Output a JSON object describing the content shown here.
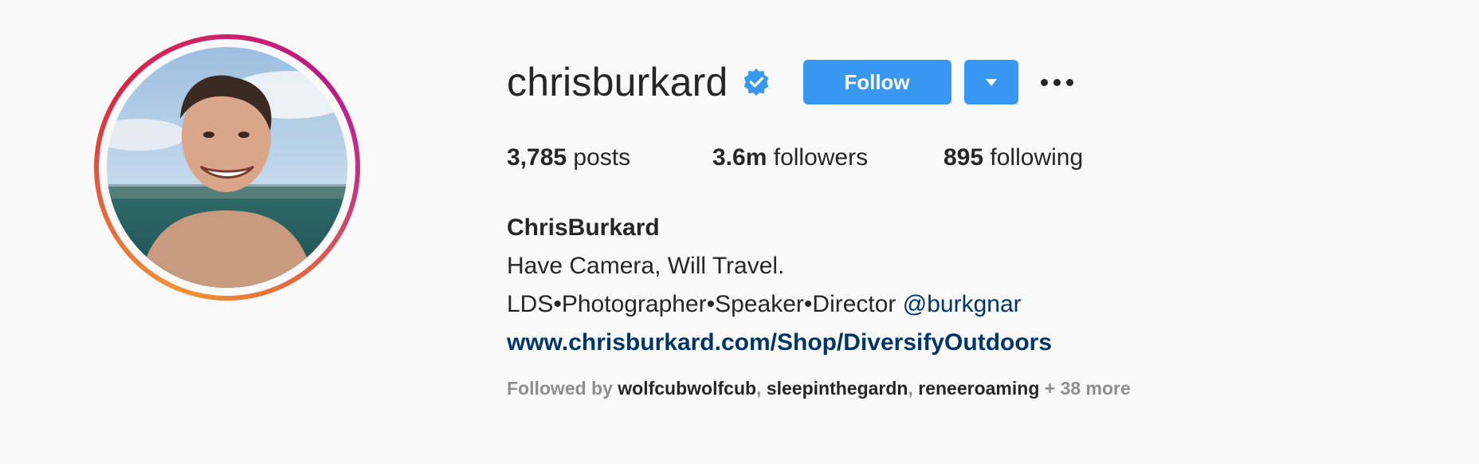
{
  "profile": {
    "username": "chrisburkard",
    "follow_label": "Follow",
    "stats": {
      "posts_count": "3,785",
      "posts_label": "posts",
      "followers_count": "3.6m",
      "followers_label": "followers",
      "following_count": "895",
      "following_label": "following"
    },
    "full_name": "ChrisBurkard",
    "bio_line1": "Have Camera, Will Travel.",
    "bio_line2": "LDS•Photographer•Speaker•Director",
    "mention": "@burkgnar",
    "website": "www.chrisburkard.com/Shop/DiversifyOutdoors",
    "followed_by": {
      "prefix": "Followed by",
      "users": [
        "wolfcubwolfcub",
        "sleepinthegardn",
        "reneeroaming"
      ],
      "more": "+ 38 more"
    }
  },
  "colors": {
    "button": "#3897f0",
    "verified": "#3897f0",
    "link": "#003569",
    "text": "#262626",
    "muted": "#8e8e8e",
    "background": "#fafafa"
  },
  "icons": {
    "verified": "verified-badge-icon",
    "dropdown": "caret-down-icon",
    "more": "more-options-icon"
  }
}
